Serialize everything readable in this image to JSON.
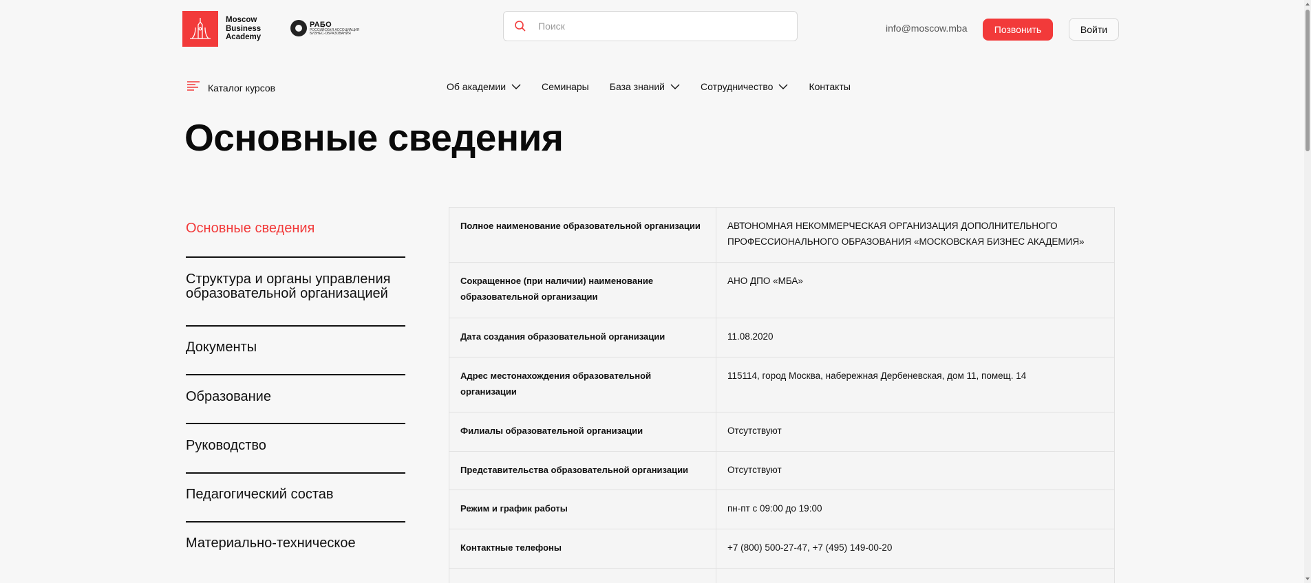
{
  "colors": {
    "accent": "#f23a3a",
    "text": "#111111",
    "background": "#f7f7f7"
  },
  "header": {
    "logo_mba": {
      "line1": "Moscow",
      "line2": "Business",
      "line3": "Academy"
    },
    "logo_rabo": {
      "title": "РАБО",
      "sub": "РОССИЙСКАЯ АССОЦИАЦИЯ БИЗНЕС-ОБРАЗОВАНИЯ"
    },
    "search": {
      "placeholder": "Поиск",
      "icon": "search-icon"
    },
    "email": "info@moscow.mba",
    "call_label": "Позвонить",
    "login_label": "Войти"
  },
  "nav": {
    "catalog_label": "Каталог курсов",
    "items": [
      {
        "label": "Об академии",
        "dropdown": true
      },
      {
        "label": "Семинары",
        "dropdown": false
      },
      {
        "label": "База знаний",
        "dropdown": true
      },
      {
        "label": "Сотрудничество",
        "dropdown": true
      },
      {
        "label": "Контакты",
        "dropdown": false
      }
    ]
  },
  "page_title": "Основные сведения",
  "side_menu": [
    {
      "label": "Основные сведения",
      "active": true
    },
    {
      "label": "Структура и органы управления образовательной организацией",
      "active": false
    },
    {
      "label": "Документы",
      "active": false
    },
    {
      "label": "Образование",
      "active": false
    },
    {
      "label": "Руководство",
      "active": false
    },
    {
      "label": "Педагогический состав",
      "active": false
    },
    {
      "label": "Материально-техническое",
      "active": false
    }
  ],
  "table": [
    {
      "key": "Полное наименование образовательной организации",
      "value": "АВТОНОМНАЯ НЕКОММЕРЧЕСКАЯ ОРГАНИЗАЦИЯ ДОПОЛНИТЕЛЬНОГО ПРОФЕССИОНАЛЬНОГО ОБРАЗОВАНИЯ «МОСКОВСКАЯ БИЗНЕС АКАДЕМИЯ»"
    },
    {
      "key": "Сокращенное (при наличии) наименование образовательной организации",
      "value": "АНО ДПО «МБА»"
    },
    {
      "key": "Дата создания образовательной организации",
      "value": "11.08.2020"
    },
    {
      "key": "Адрес местонахождения образовательной организации",
      "value": "115114, город Москва, набережная Дербеневская, дом 11, помещ. 14"
    },
    {
      "key": "Филиалы образовательной организации",
      "value": "Отсутствуют"
    },
    {
      "key": "Представительства образовательной организации",
      "value": "Отсутствуют"
    },
    {
      "key": "Режим и график работы",
      "value": "пн-пт с 09:00 до 19:00"
    },
    {
      "key": "Контактные телефоны",
      "value": "+7 (800) 500-27-47, +7 (495) 149-00-20"
    },
    {
      "key": "",
      "value": ""
    }
  ]
}
